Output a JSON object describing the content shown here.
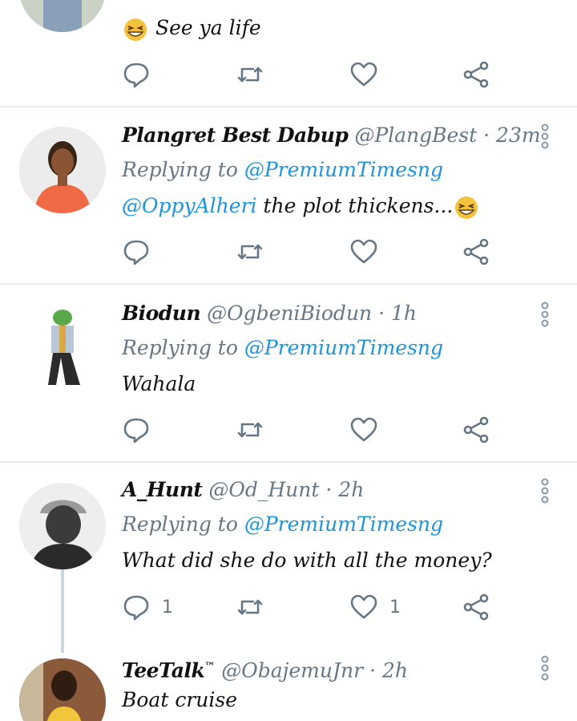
{
  "colors": {
    "link": "#1b95e0",
    "muted": "#657786",
    "divider": "#e6ecf0",
    "text": "#111111"
  },
  "tweets": [
    {
      "body": "See ya life",
      "body_emoji": "grinning-squinting-face",
      "reply_count": "",
      "like_count": ""
    },
    {
      "name": "Plangret Best Dabup",
      "handle": "@PlangBest",
      "dot": "·",
      "time": "23m",
      "replying_prefix": "Replying to",
      "replying_to": "@PremiumTimesng",
      "body_mention": "@OppyAlheri",
      "body": "the plot thickens...",
      "body_emoji": "grinning-squinting-face",
      "reply_count": "",
      "like_count": ""
    },
    {
      "name": "Biodun",
      "handle": "@OgbeniBiodun",
      "dot": "·",
      "time": "1h",
      "replying_prefix": "Replying to",
      "replying_to": "@PremiumTimesng",
      "body": "Wahala",
      "reply_count": "",
      "like_count": ""
    },
    {
      "name": "A_Hunt",
      "handle": "@Od_Hunt",
      "dot": "·",
      "time": "2h",
      "replying_prefix": "Replying to",
      "replying_to": "@PremiumTimesng",
      "body": "What did she do with all the money?",
      "reply_count": "1",
      "like_count": "1"
    },
    {
      "name": "TeeTalk",
      "name_suffix": "™",
      "handle": "@ObajemuJnr",
      "dot": "·",
      "time": "2h",
      "body": "Boat cruise"
    }
  ],
  "icons": {
    "reply": "reply-icon",
    "retweet": "retweet-icon",
    "like": "like-icon",
    "share": "share-icon",
    "more": "more-vertical-icon"
  }
}
